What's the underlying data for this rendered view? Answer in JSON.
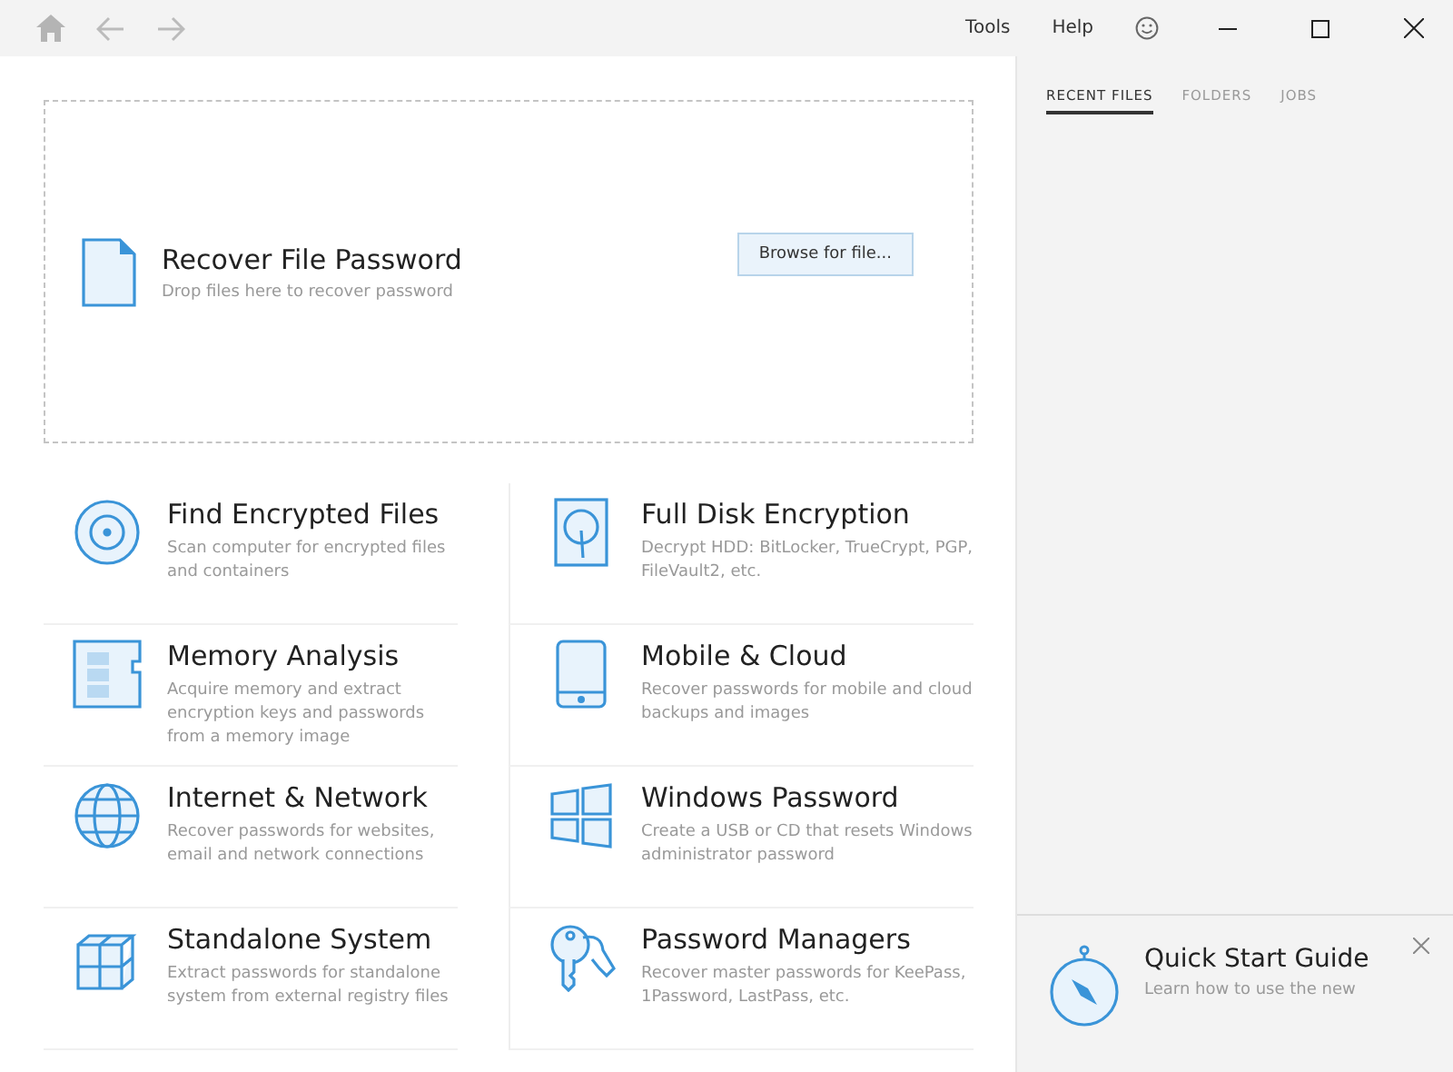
{
  "toolbar": {
    "menu": [
      "Tools",
      "Help"
    ]
  },
  "drop_zone": {
    "title": "Recover File Password",
    "subtitle": "Drop files here to recover password",
    "button": "Browse for file..."
  },
  "tiles": [
    {
      "kind": "disc",
      "title": "Find Encrypted Files",
      "description": "Scan computer for encrypted files and containers"
    },
    {
      "kind": "disk",
      "title": "Full Disk Encryption",
      "description": "Decrypt HDD: BitLocker, TrueCrypt, PGP, FileVault2, etc."
    },
    {
      "kind": "memory",
      "title": "Memory Analysis",
      "description": "Acquire memory and extract encryption keys and passwords from a memory image"
    },
    {
      "kind": "mobile",
      "title": "Mobile & Cloud",
      "description": "Recover passwords for mobile and cloud backups and images"
    },
    {
      "kind": "globe",
      "title": "Internet & Network",
      "description": "Recover passwords for websites, email and network connections"
    },
    {
      "kind": "windows",
      "title": "Windows Password",
      "description": "Create a USB or CD that resets Windows administrator password"
    },
    {
      "kind": "cubes",
      "title": "Standalone System",
      "description": "Extract passwords for standalone system from external registry files"
    },
    {
      "kind": "keys",
      "title": "Password Managers",
      "description": "Recover master passwords for KeePass, 1Password, LastPass, etc."
    }
  ],
  "side_tabs": [
    {
      "label": "RECENT FILES",
      "selected": true
    },
    {
      "label": "FOLDERS",
      "selected": false
    },
    {
      "label": "JOBS",
      "selected": false
    }
  ],
  "quick_start": {
    "title": "Quick Start Guide",
    "text": "Learn how to use the new"
  }
}
